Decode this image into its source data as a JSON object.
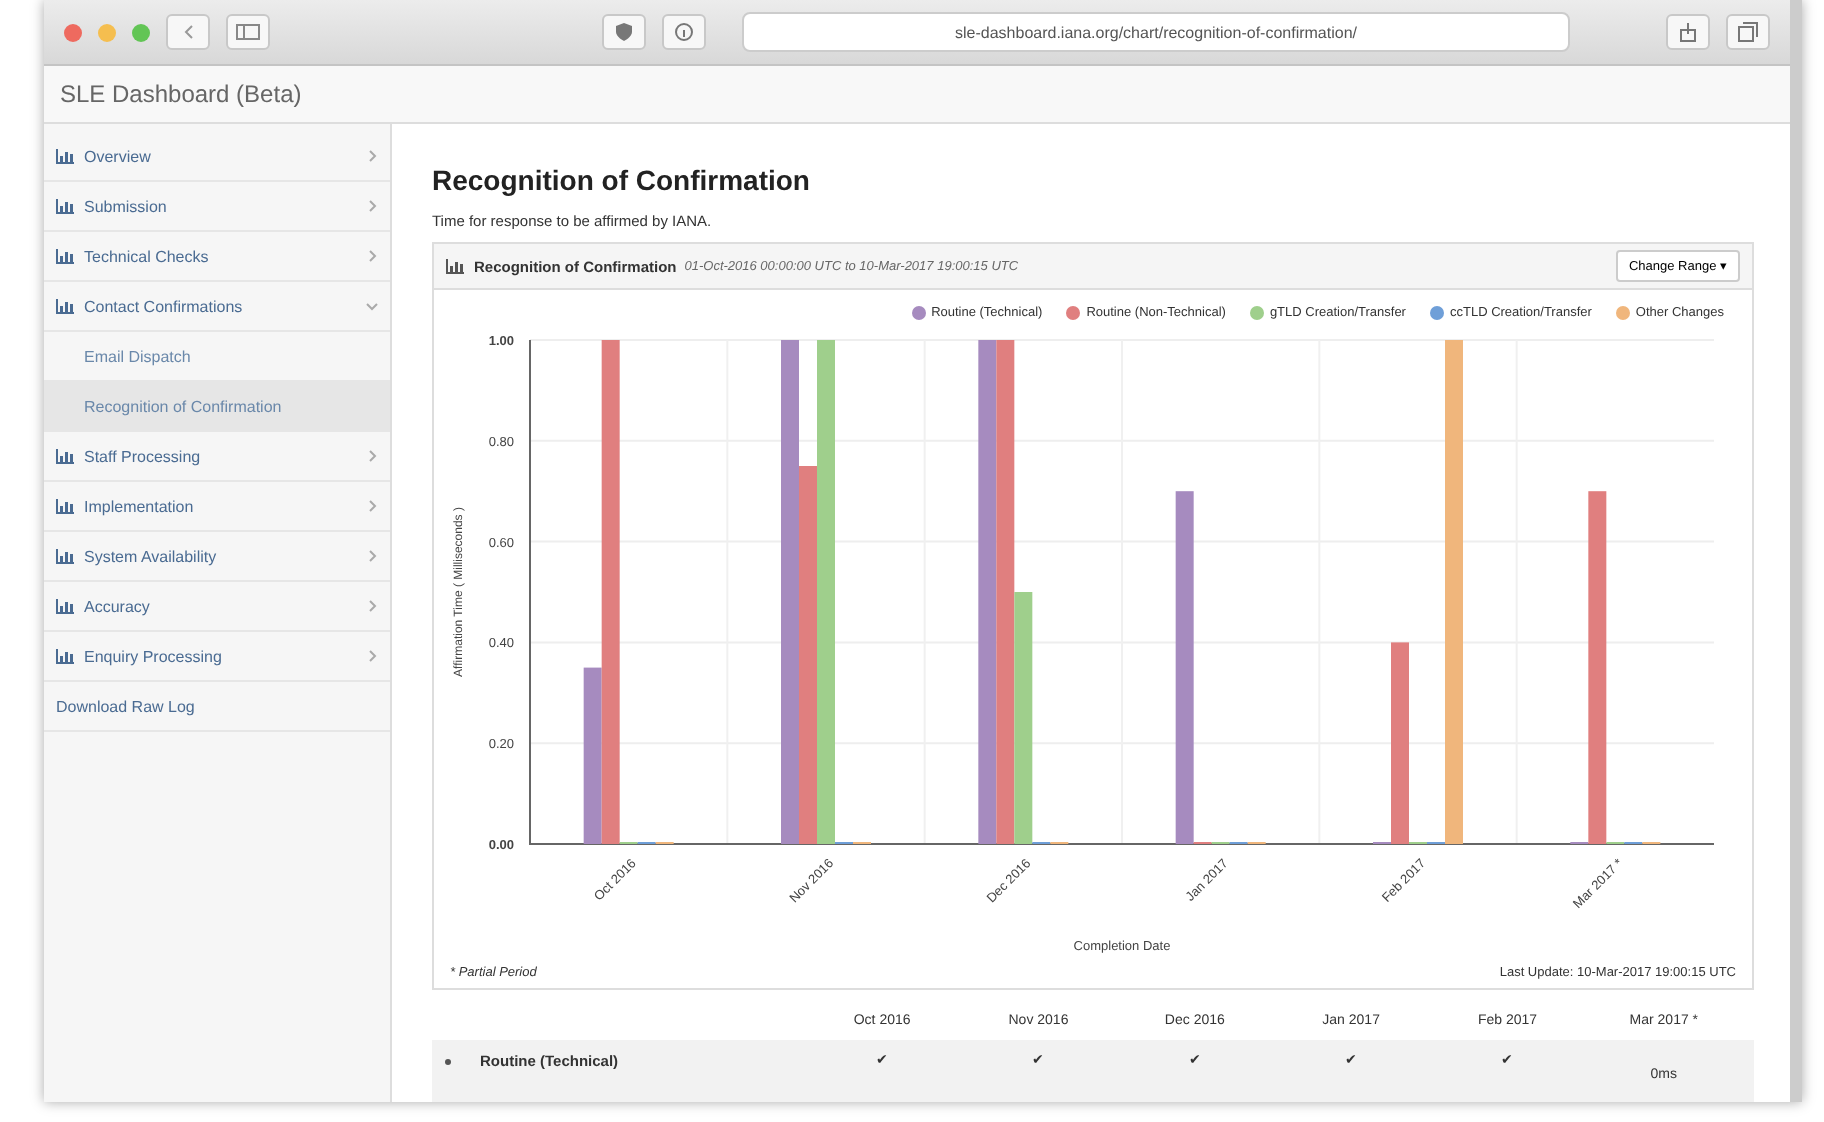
{
  "window": {
    "url": "sle-dashboard.iana.org/chart/recognition-of-confirmation/",
    "title": "SLE Dashboard (Beta)"
  },
  "sidebar": {
    "items": [
      {
        "label": "Overview",
        "icon": true,
        "expandable": true,
        "selected": false
      },
      {
        "label": "Submission",
        "icon": true,
        "expandable": true,
        "selected": false
      },
      {
        "label": "Technical Checks",
        "icon": true,
        "expandable": true,
        "selected": false
      },
      {
        "label": "Contact Confirmations",
        "icon": true,
        "expandable": true,
        "expanded": true,
        "selected": false,
        "children": [
          {
            "label": "Email Dispatch",
            "selected": false
          },
          {
            "label": "Recognition of Confirmation",
            "selected": true
          }
        ]
      },
      {
        "label": "Staff Processing",
        "icon": true,
        "expandable": true,
        "selected": false
      },
      {
        "label": "Implementation",
        "icon": true,
        "expandable": true,
        "selected": false
      },
      {
        "label": "System Availability",
        "icon": true,
        "expandable": true,
        "selected": false
      },
      {
        "label": "Accuracy",
        "icon": true,
        "expandable": true,
        "selected": false
      },
      {
        "label": "Enquiry Processing",
        "icon": true,
        "expandable": true,
        "selected": false
      },
      {
        "label": "Download Raw Log",
        "icon": false,
        "expandable": false,
        "selected": false
      }
    ]
  },
  "page": {
    "heading": "Recognition of Confirmation",
    "description": "Time for response to be affirmed by IANA."
  },
  "panel": {
    "title": "Recognition of Confirmation",
    "range": "01-Oct-2016 00:00:00 UTC to 10-Mar-2017 19:00:15 UTC",
    "button": "Change Range ▾",
    "chart_data": {
      "type": "bar",
      "xlabel": "Completion Date",
      "ylabel": "Affirmation Time ( Milliseconds )",
      "categories": [
        "Oct 2016",
        "Nov 2016",
        "Dec 2016",
        "Jan 2017",
        "Feb 2017",
        "Mar 2017 *"
      ],
      "ylim": [
        0,
        1
      ],
      "grid": true,
      "legend": "top-right",
      "yticks": [
        {
          "value": 0,
          "label": "0.00"
        },
        {
          "value": 0.2,
          "label": "0.20"
        },
        {
          "value": 0.4,
          "label": "0.40"
        },
        {
          "value": 0.6,
          "label": "0.60"
        },
        {
          "value": 0.8,
          "label": "0.80"
        },
        {
          "value": 1,
          "label": "1.00"
        }
      ],
      "series": [
        {
          "name": "Routine (Technical)",
          "color": "#a68bbf",
          "values": [
            0.35,
            1,
            1,
            0.7,
            0,
            0
          ]
        },
        {
          "name": "Routine (Non-Technical)",
          "color": "#e07f7f",
          "values": [
            1,
            0.75,
            1,
            0,
            0.4,
            0.7
          ]
        },
        {
          "name": "gTLD Creation/Transfer",
          "color": "#9fcf8c",
          "values": [
            0,
            1,
            0.5,
            0,
            0,
            0
          ]
        },
        {
          "name": "ccTLD Creation/Transfer",
          "color": "#6f9fd8",
          "values": [
            0,
            0,
            0,
            0,
            0,
            0
          ]
        },
        {
          "name": "Other Changes",
          "color": "#f0b67c",
          "values": [
            0,
            0,
            0,
            0,
            1,
            0
          ]
        }
      ]
    },
    "footnote": "* Partial Period",
    "last_update": "Last Update: 10-Mar-2017 19:00:15 UTC"
  },
  "table": {
    "columns": [
      "Oct 2016",
      "Nov 2016",
      "Dec 2016",
      "Jan 2017",
      "Feb 2017",
      "Mar 2017 *"
    ],
    "rows": [
      {
        "label": "Routine (Technical)",
        "cells": [
          "✔",
          "✔",
          "✔",
          "✔",
          "✔",
          "0ms"
        ]
      }
    ]
  }
}
